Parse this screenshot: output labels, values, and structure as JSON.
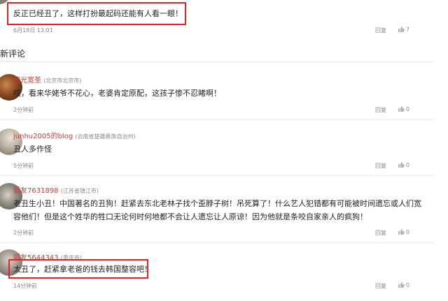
{
  "top_comment": {
    "user_partial": "",
    "text": "反正已经丑了，这样打扮最起码还能有人看一眼！",
    "time": "6月18日 13:01",
    "reply": "回复",
    "likes": "7"
  },
  "section_title": "新评论",
  "comments": [
    {
      "user": "阳光宽圣",
      "location": "(北京市北京市)",
      "text": "哎，看来华姥爷不花心，老婆肯定原配，这孩子惨不忍睹啊！",
      "time": "2分钟前",
      "reply": "回复",
      "likes": "0"
    },
    {
      "user": "junhu2005的blog",
      "location": "(云南省楚雄彝族自治州)",
      "text": "丑人多作怪",
      "time": "5分钟前",
      "reply": "回复",
      "likes": "0"
    },
    {
      "user": "狐友7631898",
      "location": "(江苏省镇江市)",
      "text": "老丑生小丑！中国著名的丑狗！赶紧去东北老林子找个歪脖子树！吊死算了！什么艺人犯错都有可能被时间遗忘或人们宽容他们！但是这个姓华的牲口无论何时何地都不会让人遗忘让人原谅！因为他就是条咬自家亲人的疯狗！",
      "time": "2分钟前",
      "reply": "回复",
      "likes": "0"
    },
    {
      "user": "狐友5644343",
      "location": "(重庆市)",
      "text": "太丑了，赶紧拿老爸的钱去韩国整容吧！",
      "time": "14分钟前",
      "reply": "回复",
      "likes": "0"
    }
  ]
}
